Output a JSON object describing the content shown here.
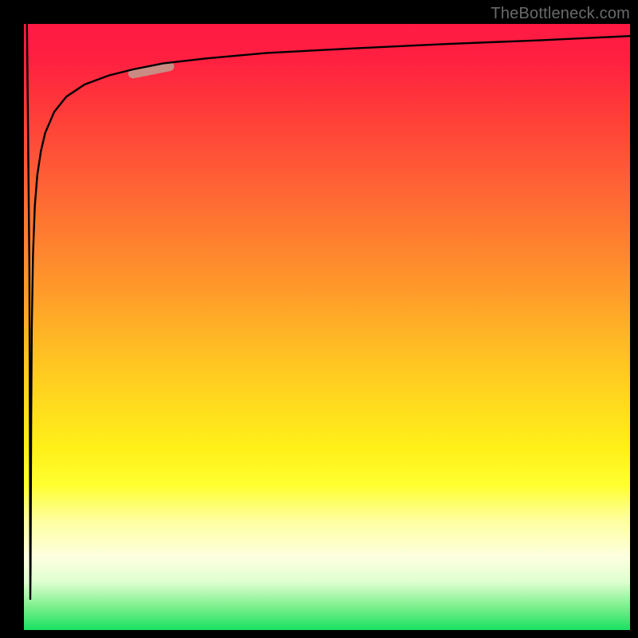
{
  "watermark": "TheBottleneck.com",
  "colors": {
    "frame": "#000000",
    "curve": "#000000",
    "marker": "#c98b82",
    "gradient_top": "#ff1a44",
    "gradient_bottom": "#18e060"
  },
  "chart_data": {
    "type": "line",
    "title": "",
    "xlabel": "",
    "ylabel": "",
    "xlim": [
      0,
      100
    ],
    "ylim": [
      0,
      100
    ],
    "grid": false,
    "legend": false,
    "series": [
      {
        "name": "curve",
        "x": [
          0.5,
          0.9,
          1.0,
          1.05,
          1.1,
          1.15,
          1.2,
          1.3,
          1.5,
          1.8,
          2.2,
          2.8,
          3.5,
          5,
          7,
          10,
          14,
          18,
          23,
          30,
          40,
          55,
          70,
          85,
          100
        ],
        "values": [
          100,
          60,
          25,
          5,
          10,
          22,
          35,
          50,
          62,
          70,
          75,
          79,
          82,
          85.5,
          88,
          90,
          91.5,
          92.5,
          93.5,
          94.3,
          95.2,
          96,
          96.7,
          97.3,
          98
        ]
      }
    ],
    "annotations": [
      {
        "name": "marker",
        "type": "segment",
        "x0": 18,
        "y0": 91.8,
        "x1": 24,
        "y1": 93.0,
        "color": "#c98b82",
        "thickness": 12
      }
    ]
  }
}
